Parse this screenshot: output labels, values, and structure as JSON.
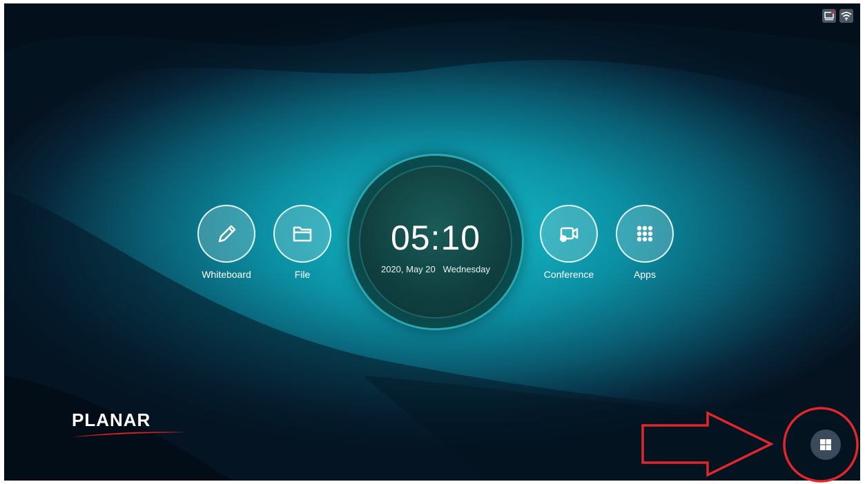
{
  "status_bar": {
    "icons": [
      "screen-cast-icon",
      "wifi-icon"
    ]
  },
  "tiles_left": [
    {
      "label": "Whiteboard",
      "icon": "pencil-icon"
    },
    {
      "label": "File",
      "icon": "folder-icon"
    }
  ],
  "tiles_right": [
    {
      "label": "Conference",
      "icon": "video-conference-icon"
    },
    {
      "label": "Apps",
      "icon": "apps-grid-icon"
    }
  ],
  "clock": {
    "time": "05:10",
    "date": "2020, May 20",
    "weekday": "Wednesday"
  },
  "brand": {
    "name": "PLANAR",
    "accent": "#d0202a"
  },
  "source_button": {
    "icon": "windows-icon"
  },
  "annotation": {
    "color": "#e3262b",
    "shapes": [
      "arrow",
      "circle"
    ]
  },
  "colors": {
    "background": "#0a5d72",
    "highlight": "#16c3d0"
  }
}
